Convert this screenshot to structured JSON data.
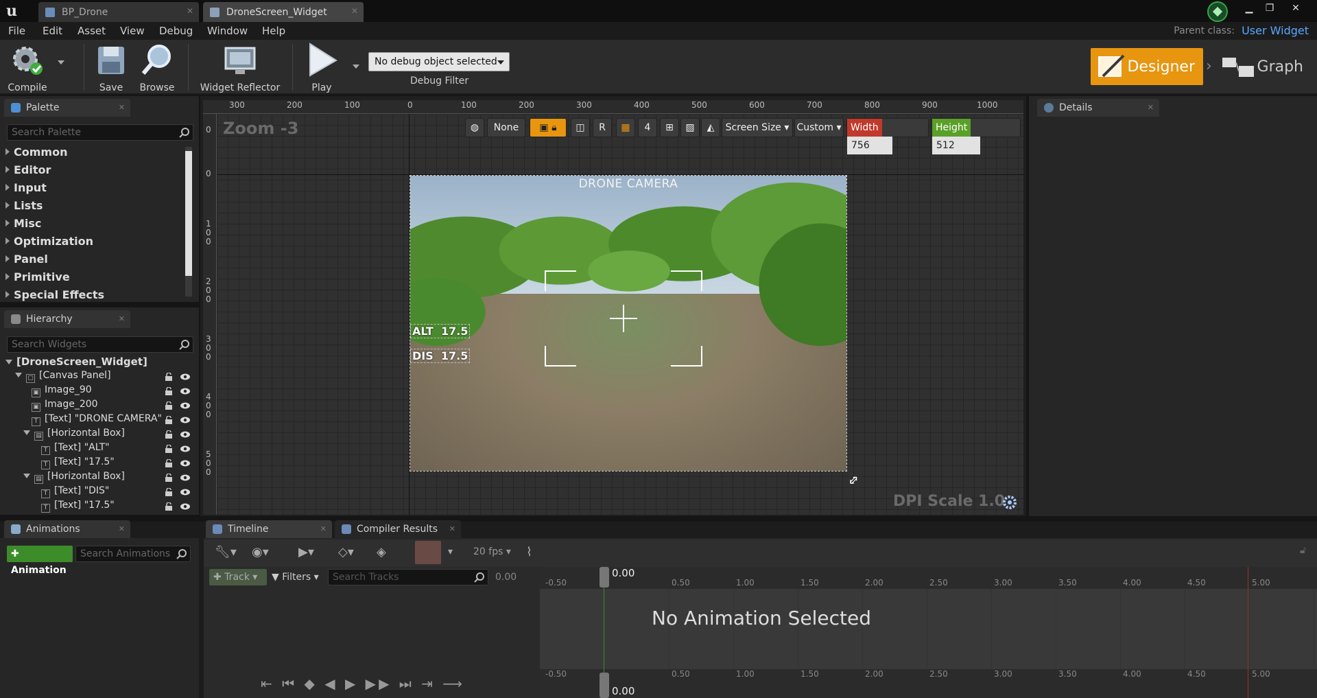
{
  "window": {
    "tabs": [
      {
        "label": "BP_Drone"
      },
      {
        "label": "DroneScreen_Widget"
      }
    ]
  },
  "menu": [
    "File",
    "Edit",
    "Asset",
    "View",
    "Debug",
    "Window",
    "Help"
  ],
  "parent_class": {
    "label": "Parent class:",
    "value": "User Widget"
  },
  "toolbar": {
    "compile": "Compile",
    "save": "Save",
    "browse": "Browse",
    "widget_reflector": "Widget Reflector",
    "play": "Play",
    "debug_object": "No debug object selected",
    "debug_filter": "Debug Filter",
    "designer": "Designer",
    "graph": "Graph"
  },
  "palette": {
    "title": "Palette",
    "search_placeholder": "Search Palette",
    "categories": [
      "Common",
      "Editor",
      "Input",
      "Lists",
      "Misc",
      "Optimization",
      "Panel",
      "Primitive",
      "Special Effects"
    ]
  },
  "hierarchy": {
    "title": "Hierarchy",
    "search_placeholder": "Search Widgets",
    "root": "[DroneScreen_Widget]",
    "items": [
      {
        "label": "[Canvas Panel]"
      },
      {
        "label": "Image_90"
      },
      {
        "label": "Image_200"
      },
      {
        "label": "[Text] \"DRONE CAMERA\""
      },
      {
        "label": "[Horizontal Box]"
      },
      {
        "label": "[Text] \"ALT\""
      },
      {
        "label": "[Text] \"17.5\""
      },
      {
        "label": "[Horizontal Box]"
      },
      {
        "label": "[Text] \"DIS\""
      },
      {
        "label": "[Text] \"17.5\""
      }
    ]
  },
  "designer": {
    "zoom": "Zoom -3",
    "dpi_scale": "DPI Scale 1.0",
    "ruler_h": [
      "300",
      "200",
      "100",
      "0",
      "100",
      "200",
      "300",
      "400",
      "500",
      "600",
      "700",
      "800",
      "900",
      "1000"
    ],
    "ruler_v": [
      "0",
      "0",
      "100",
      "200",
      "300",
      "400",
      "500"
    ],
    "view_none": "None",
    "view_r": "R",
    "grid_snap": "4",
    "screen_size": "Screen Size",
    "custom": "Custom",
    "width_label": "Width",
    "width_value": "756",
    "height_label": "Height",
    "height_value": "512"
  },
  "widget_preview": {
    "title": "DRONE CAMERA",
    "alt_label": "ALT",
    "alt_value": "17.5",
    "dis_label": "DIS",
    "dis_value": "17.5"
  },
  "details": {
    "title": "Details"
  },
  "animations": {
    "title": "Animations",
    "add_button": "Animation",
    "search_placeholder": "Search Animations"
  },
  "timeline": {
    "tab_timeline": "Timeline",
    "tab_compiler": "Compiler Results",
    "fps": "20 fps",
    "track_button": "Track",
    "filters": "Filters",
    "search_placeholder": "Search Tracks",
    "time_value": "0.00",
    "playhead_top": "0.00",
    "playhead_bottom": "0.00",
    "ruler": [
      "-0.50",
      "0.50",
      "1.00",
      "1.50",
      "2.00",
      "2.50",
      "3.00",
      "3.50",
      "4.00",
      "4.50",
      "5.00"
    ],
    "empty_message": "No Animation Selected"
  },
  "colors": {
    "accent_orange": "#e8950f",
    "link_blue": "#5aa8ff",
    "width_red": "#c0392b",
    "height_green": "#5aa028",
    "add_green": "#3d8c2a"
  }
}
